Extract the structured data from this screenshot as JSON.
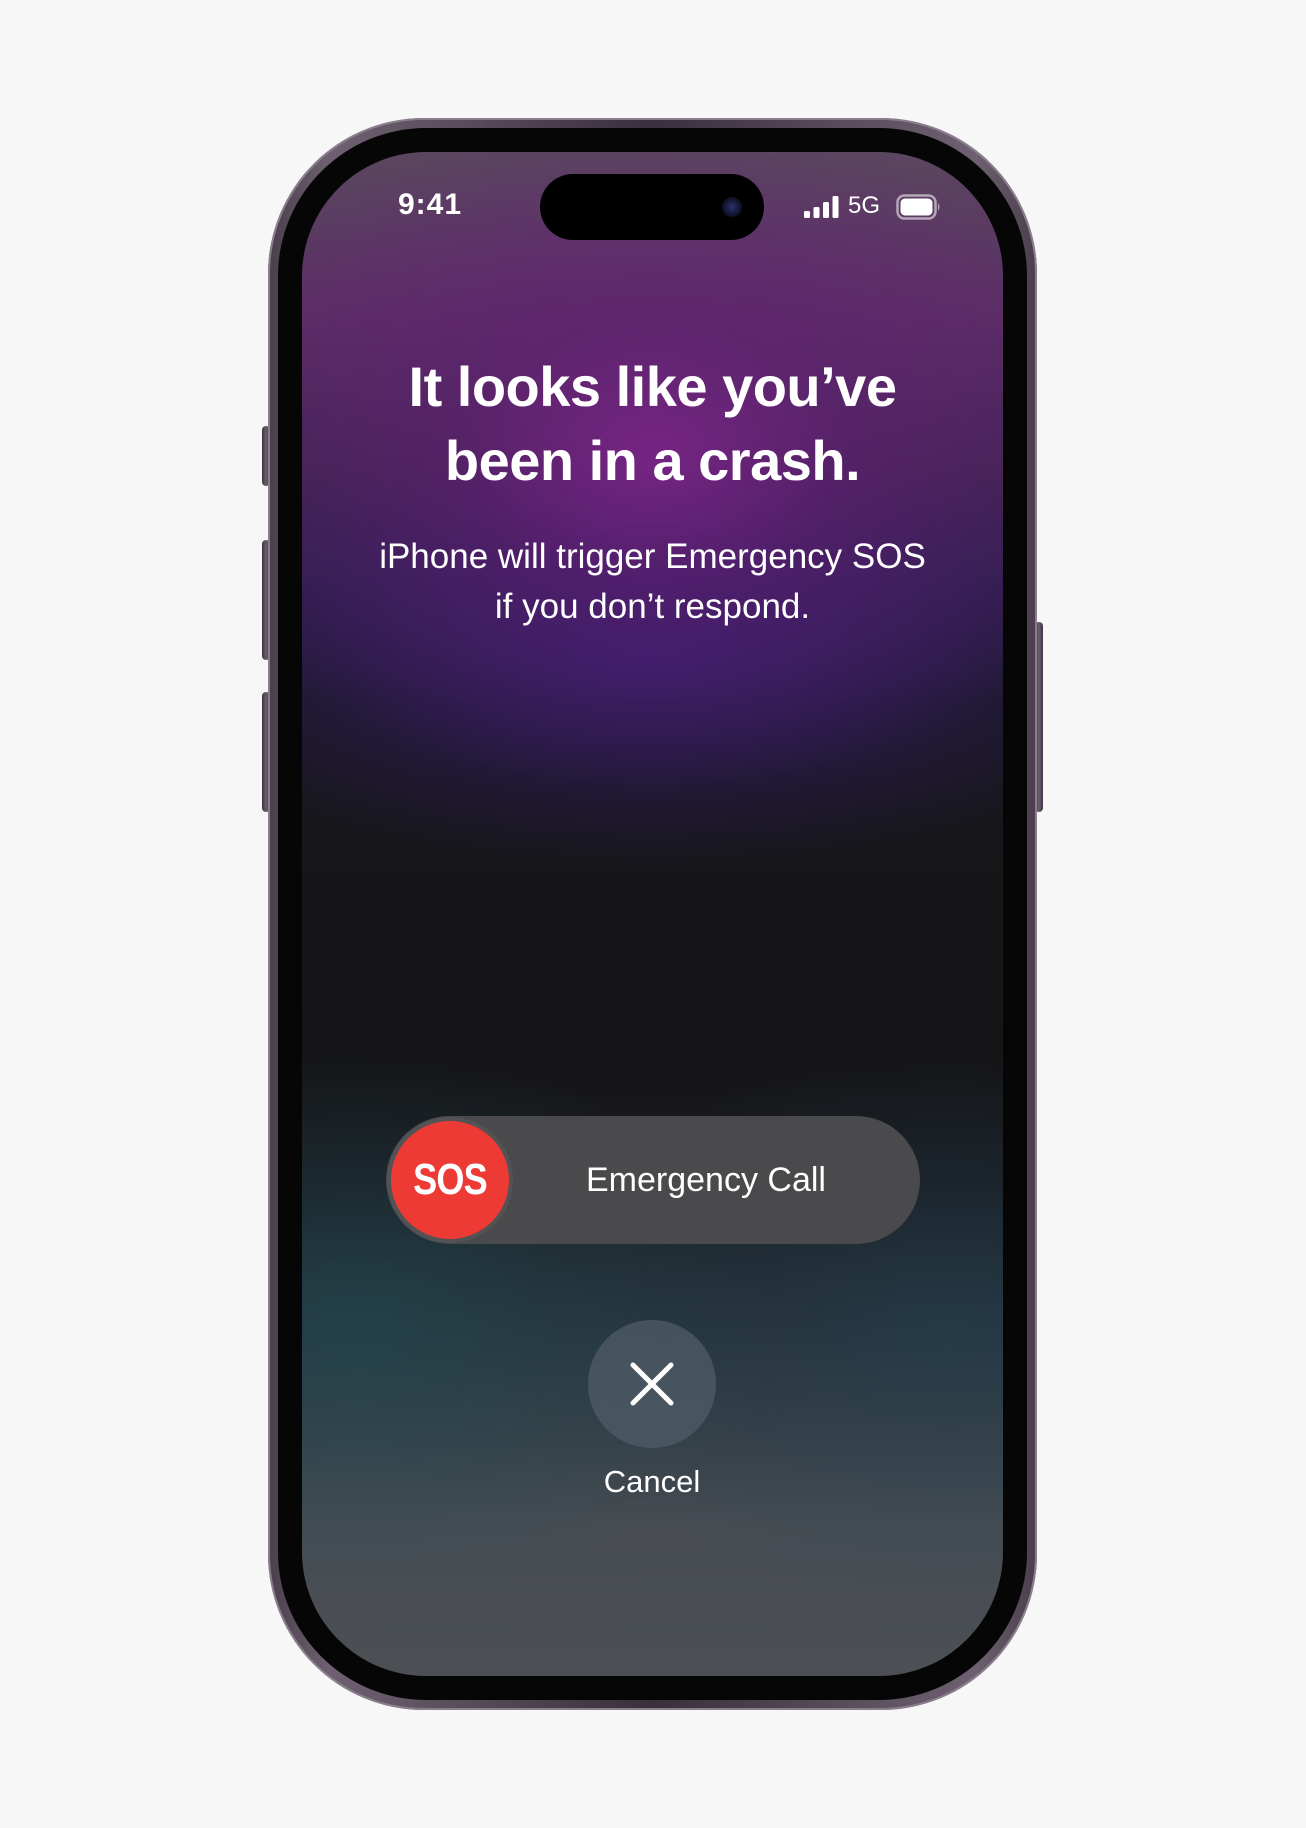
{
  "status_bar": {
    "time": "9:41",
    "network": "5G",
    "signal_icon": "cellular-signal-icon",
    "battery_icon": "battery-icon"
  },
  "alert": {
    "headline_line1": "It looks like you’ve",
    "headline_line2": "been in a crash.",
    "message_line1": "iPhone will trigger Emergency SOS",
    "message_line2": "if you don’t respond."
  },
  "sos_slider": {
    "knob_label": "SOS",
    "label": "Emergency Call",
    "knob_color": "#EE3A34"
  },
  "cancel": {
    "icon": "close-icon",
    "label": "Cancel"
  },
  "colors": {
    "accent_purple": "#5A2F63",
    "sos_red": "#EE3A34",
    "slider_track": "#4A4A4D"
  }
}
